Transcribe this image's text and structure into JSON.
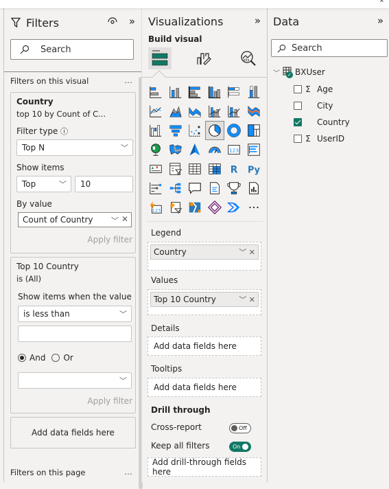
{
  "filters_pane": {
    "title": "Filters",
    "search_placeholder": "Search",
    "section_visual": "Filters on this visual",
    "section_page": "Filters on this page",
    "more": "…",
    "card1": {
      "field": "Country",
      "summary": "top 10 by Count of C...",
      "filter_type_label": "Filter type",
      "filter_type_value": "Top N",
      "show_items_label": "Show items",
      "show_items_direction": "Top",
      "show_items_count": "10",
      "by_value_label": "By value",
      "by_value_field": "Count of Country",
      "apply": "Apply filter"
    },
    "card2": {
      "field": "Top 10 Country",
      "summary": "is (All)",
      "condition_label": "Show items when the value",
      "condition_value": "is less than",
      "condition_input": "",
      "logic_and": "And",
      "logic_or": "Or",
      "logic_selected": "And",
      "condition2_value": "",
      "apply": "Apply filter"
    },
    "add_fields": "Add data fields here"
  },
  "visualizations_pane": {
    "title": "Visualizations",
    "build_visual": "Build visual",
    "wells": {
      "legend": {
        "label": "Legend",
        "field": "Country"
      },
      "values": {
        "label": "Values",
        "field": "Top 10 Country"
      },
      "details": {
        "label": "Details",
        "placeholder": "Add data fields here"
      },
      "tooltips": {
        "label": "Tooltips",
        "placeholder": "Add data fields here"
      }
    },
    "drill_through": {
      "label": "Drill through",
      "cross_report": {
        "label": "Cross-report",
        "state": "Off"
      },
      "keep_all_filters": {
        "label": "Keep all filters",
        "state": "On"
      },
      "placeholder": "Add drill-through fields here"
    },
    "visual_icons": [
      "stacked-bar-chart",
      "stacked-column-chart",
      "clustered-bar-chart",
      "clustered-column-chart",
      "100-stacked-bar-chart",
      "100-stacked-column-chart",
      "line-chart",
      "area-chart",
      "stacked-area-chart",
      "line-clustered-column-chart",
      "line-stacked-column-chart",
      "ribbon-chart",
      "waterfall-chart",
      "funnel-chart",
      "scatter-chart",
      "pie-chart",
      "donut-chart",
      "treemap",
      "map",
      "filled-map",
      "azure-map",
      "gauge",
      "card",
      "multi-row-card",
      "kpi",
      "slicer",
      "table",
      "matrix",
      "r-visual",
      "python-visual",
      "key-influencers",
      "decomposition-tree",
      "qa",
      "smart-narrative",
      "metrics",
      "paginated-report",
      "power-apps-card",
      "power-apps-slicer",
      "arcgis-map",
      "power-apps",
      "power-automate",
      "more-visuals"
    ],
    "selected_visual": "pie-chart"
  },
  "data_pane": {
    "title": "Data",
    "search_placeholder": "Search",
    "table": "BXUser",
    "fields": [
      {
        "name": "Age",
        "sigma": true,
        "checked": false
      },
      {
        "name": "City",
        "sigma": false,
        "checked": false
      },
      {
        "name": "Country",
        "sigma": false,
        "checked": true
      },
      {
        "name": "UserID",
        "sigma": true,
        "checked": false
      }
    ]
  },
  "colors": {
    "accent_green": "#117865",
    "icon_blue": "#118dff"
  }
}
